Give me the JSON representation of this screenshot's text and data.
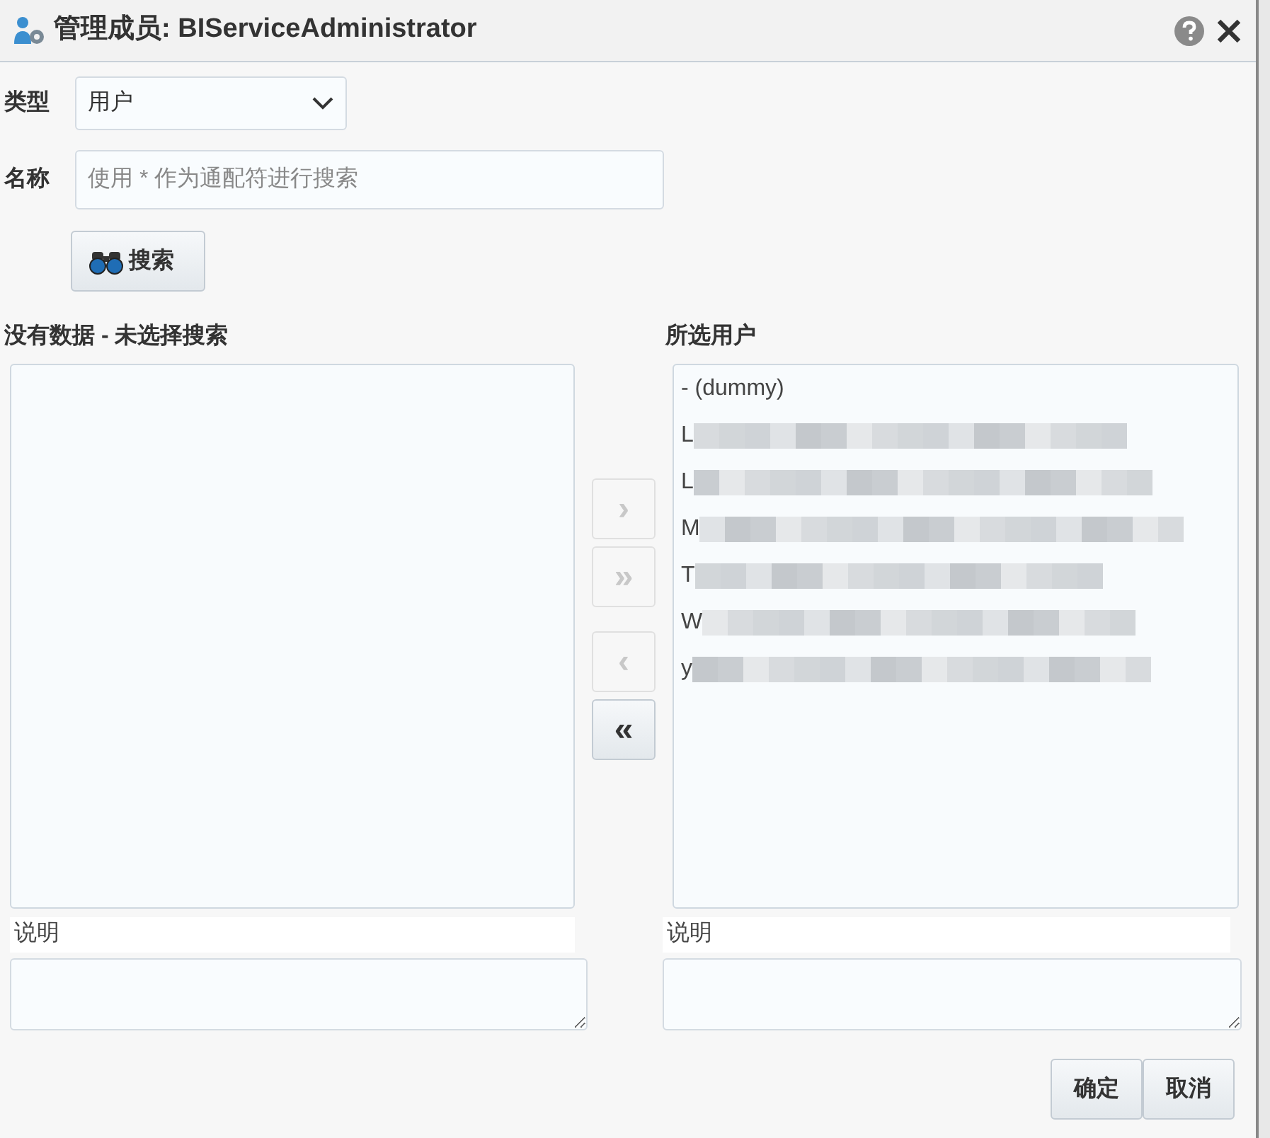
{
  "window": {
    "title": "管理成员: BIServiceAdministrator"
  },
  "form": {
    "type_label": "类型",
    "type_value": "用户",
    "name_label": "名称",
    "name_placeholder": "使用 * 作为通配符进行搜索",
    "search_button": "搜索"
  },
  "available": {
    "heading": "没有数据 - 未选择搜索",
    "description_label": "说明"
  },
  "transfer_buttons": [
    {
      "label": "›",
      "disabled": true
    },
    {
      "label": "»",
      "disabled": true
    },
    {
      "label": "‹",
      "disabled": true
    },
    {
      "label": "«",
      "disabled": false
    }
  ],
  "selected": {
    "heading": "所选用户",
    "description_label": "说明",
    "items": [
      {
        "text": "- (dummy)",
        "blurred": false
      },
      {
        "text": "L",
        "blurred": true
      },
      {
        "text": "L",
        "blurred": true
      },
      {
        "text": "M",
        "blurred": true
      },
      {
        "text": "T",
        "blurred": true
      },
      {
        "text": "W",
        "blurred": true
      },
      {
        "text": "y",
        "blurred": true
      }
    ]
  },
  "buttons": [
    "确定",
    "取消"
  ]
}
